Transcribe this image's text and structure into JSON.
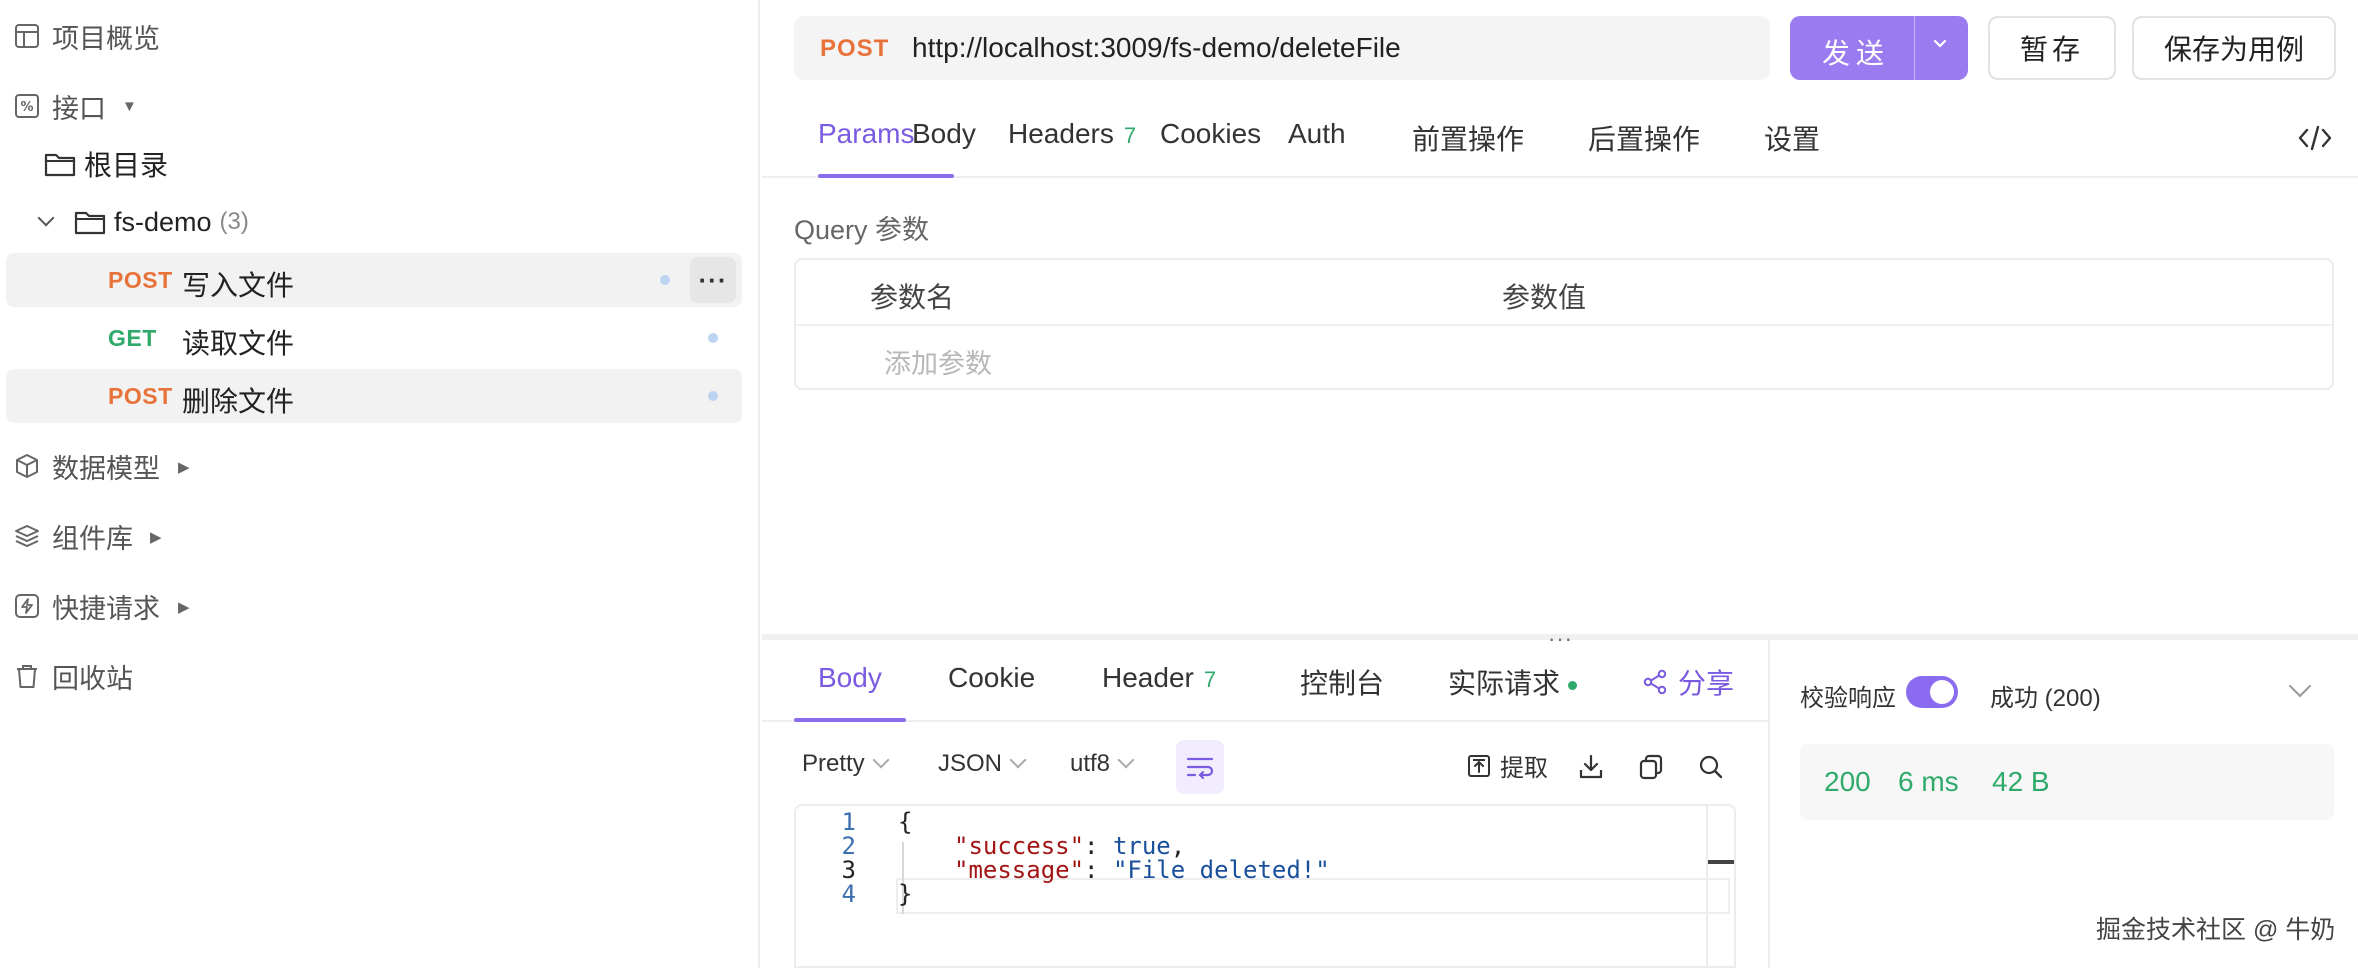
{
  "sidebar": {
    "overview": "项目概览",
    "interfaces": "接口",
    "root": "根目录",
    "folder": {
      "name": "fs-demo",
      "count": "(3)"
    },
    "apis": [
      {
        "method": "POST",
        "name": "写入文件"
      },
      {
        "method": "GET",
        "name": "读取文件"
      },
      {
        "method": "POST",
        "name": "删除文件"
      }
    ],
    "more_glyph": "···",
    "data_models": "数据模型",
    "components": "组件库",
    "quick_requests": "快捷请求",
    "recycle_bin": "回收站"
  },
  "request": {
    "method": "POST",
    "url": "http://localhost:3009/fs-demo/deleteFile",
    "send_label": "发送",
    "save_label": "暂存",
    "save_case_label": "保存为用例"
  },
  "request_tabs": {
    "params": "Params",
    "body": "Body",
    "headers": "Headers",
    "headers_count": "7",
    "cookies": "Cookies",
    "auth": "Auth",
    "pre_ops": "前置操作",
    "post_ops": "后置操作",
    "settings": "设置"
  },
  "query": {
    "label": "Query 参数",
    "col_name": "参数名",
    "col_value": "参数值",
    "add_placeholder": "添加参数"
  },
  "splitter_grip": "···",
  "response_tabs": {
    "body": "Body",
    "cookie": "Cookie",
    "header": "Header",
    "header_count": "7",
    "console": "控制台",
    "actual_request": "实际请求",
    "share": "分享"
  },
  "response_toolbar": {
    "format": "Pretty",
    "type": "JSON",
    "encoding": "utf8",
    "extract": "提取"
  },
  "code": {
    "line_numbers": [
      "1",
      "2",
      "3",
      "4"
    ],
    "open_brace": "{",
    "close_brace": "}",
    "key1": "\"success\"",
    "val1": "true",
    "key2": "\"message\"",
    "val2": "\"File deleted!\""
  },
  "validation": {
    "label": "校验响应",
    "enabled": true,
    "status_text": "成功 (200)"
  },
  "stats": {
    "status": "200",
    "time": "6 ms",
    "size": "42 B"
  },
  "watermark": "掘金技术社区 @ 牛奶",
  "colors": {
    "accent": "#8b6cf0",
    "post": "#e8733a",
    "get": "#2faa6a",
    "success": "#2faa6a"
  }
}
